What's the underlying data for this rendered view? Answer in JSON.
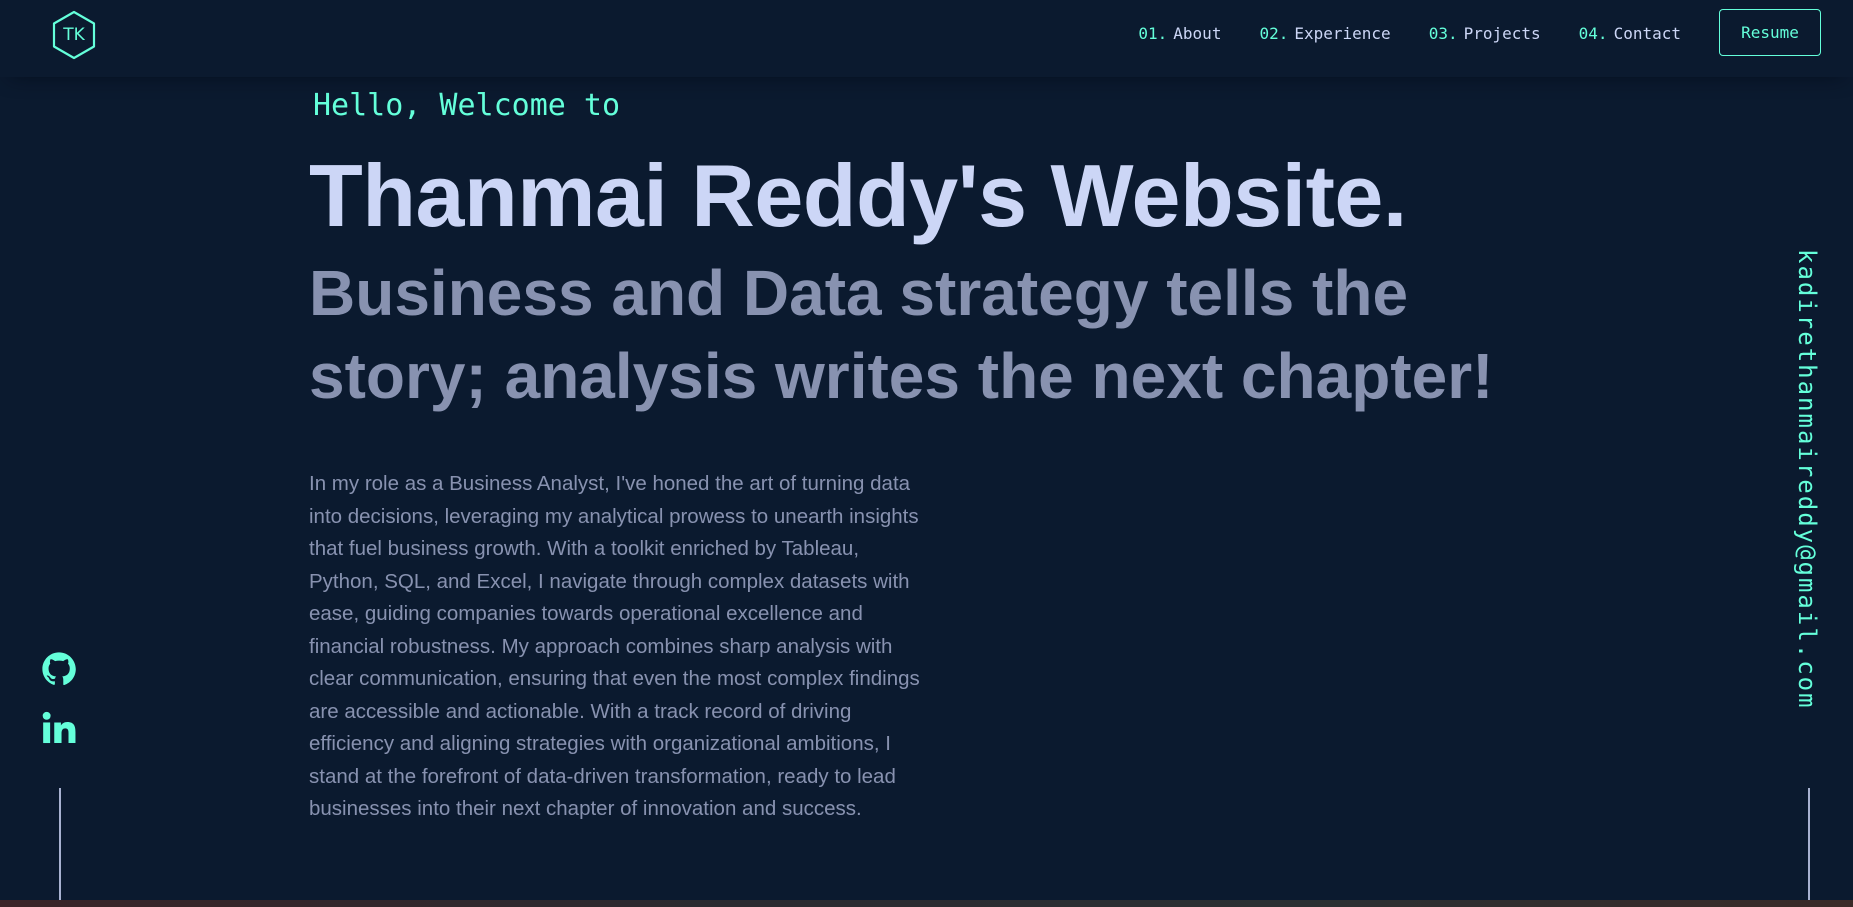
{
  "logo": {
    "initials": "TK"
  },
  "nav": {
    "items": [
      {
        "num": "01.",
        "label": "About"
      },
      {
        "num": "02.",
        "label": "Experience"
      },
      {
        "num": "03.",
        "label": "Projects"
      },
      {
        "num": "04.",
        "label": "Contact"
      }
    ],
    "resume_label": "Resume"
  },
  "hero": {
    "greeting": "Hello, Welcome to",
    "title": "Thanmai Reddy's Website.",
    "subtitle": "Business and Data strategy tells the story; analysis writes the next chapter!",
    "bio": "In my role as a Business Analyst, I've honed the art of turning data into decisions, leveraging my analytical prowess to unearth insights that fuel business growth. With a toolkit enriched by Tableau, Python, SQL, and Excel, I navigate through complex datasets with ease, guiding companies towards operational excellence and financial robustness. My approach combines sharp analysis with clear communication, ensuring that even the most complex findings are accessible and actionable. With a track record of driving efficiency and aligning strategies with organizational ambitions, I stand at the forefront of data-driven transformation, ready to lead businesses into their next chapter of innovation and success."
  },
  "social": {
    "icons": [
      "github-icon",
      "linkedin-icon"
    ]
  },
  "email": "kadirethanmaireddy@gmail.com",
  "colors": {
    "background": "#0b1a2f",
    "accent": "#64ffda",
    "heading": "#ccd6f6",
    "text": "#8892b0"
  }
}
